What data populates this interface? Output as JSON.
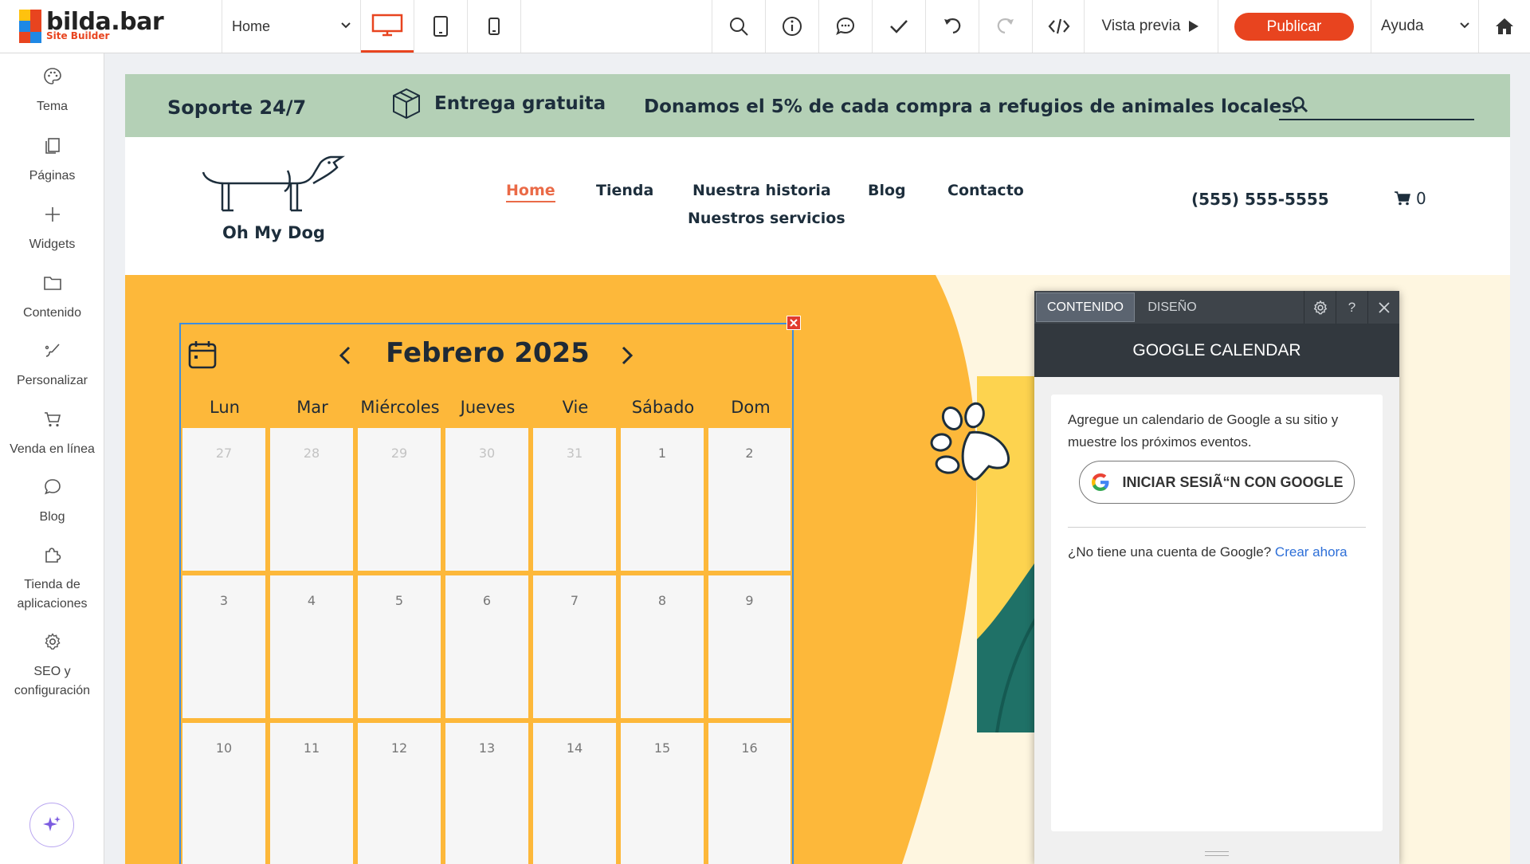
{
  "app": {
    "brand": "bilda.bar",
    "brand_sub": "Site Builder",
    "page_selector": "Home",
    "preview_label": "Vista previa",
    "publish_label": "Publicar",
    "help_label": "Ayuda",
    "accent": "#e8441f"
  },
  "sidebar": {
    "items": [
      {
        "label": "Tema",
        "icon": "palette-icon"
      },
      {
        "label": "Páginas",
        "icon": "pages-icon"
      },
      {
        "label": "Widgets",
        "icon": "plus-icon"
      },
      {
        "label": "Contenido",
        "icon": "folder-icon"
      },
      {
        "label": "Personalizar",
        "icon": "brush-icon"
      },
      {
        "label": "Venda en línea",
        "icon": "cart-icon"
      },
      {
        "label": "Blog",
        "icon": "chat-icon"
      },
      {
        "label": "Tienda de aplicaciones",
        "icon": "puzzle-icon"
      },
      {
        "label": "SEO y configuración",
        "icon": "gear-icon"
      }
    ]
  },
  "site": {
    "topstrip": {
      "support": "Soporte 24/7",
      "shipping": "Entrega gratuita",
      "donate": "Donamos el 5% de cada compra a refugios de animales locales."
    },
    "brand_name": "Oh My Dog",
    "nav": {
      "home": "Home",
      "shop": "Tienda",
      "story": "Nuestra historia",
      "blog": "Blog",
      "contact": "Contacto",
      "services": "Nuestros servicios"
    },
    "phone": "(555) 555-5555",
    "cart_count": "0",
    "colors": {
      "strip": "#b4d0b6",
      "hero": "#fdb83a",
      "cream": "#fef6e0",
      "navy": "#1d2e3c",
      "nav_active": "#ea6a47"
    }
  },
  "calendar": {
    "month_title": "Febrero 2025",
    "weekdays": [
      "Lun",
      "Mar",
      "Miércoles",
      "Jueves",
      "Vie",
      "Sábado",
      "Dom"
    ],
    "rows": [
      [
        "27",
        "28",
        "29",
        "30",
        "31",
        "1",
        "2"
      ],
      [
        "3",
        "4",
        "5",
        "6",
        "7",
        "8",
        "9"
      ],
      [
        "10",
        "11",
        "12",
        "13",
        "14",
        "15",
        "16"
      ]
    ]
  },
  "panel": {
    "tab_content": "CONTENIDO",
    "tab_design": "DISEÑO",
    "help": "?",
    "title": "GOOGLE CALENDAR",
    "description": "Agregue un calendario de Google a su sitio y muestre los próximos eventos.",
    "google_button": "INICIAR SESIÃ“N CON GOOGLE",
    "no_account": "¿No tiene una cuenta de Google?",
    "create_link": "Crear ahora"
  }
}
